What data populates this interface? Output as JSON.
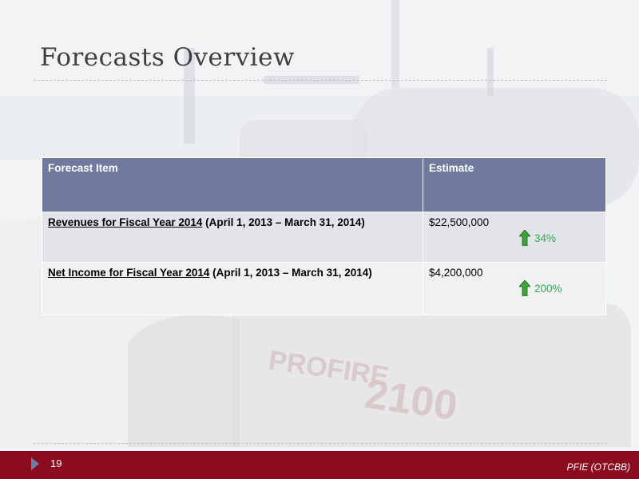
{
  "slide": {
    "title": "Forecasts Overview",
    "page_number": "19",
    "ticker": "PFIE (OTCBB)",
    "background_watermark": "PROFIRE 2100"
  },
  "table": {
    "headers": {
      "item": "Forecast Item",
      "estimate": "Estimate"
    },
    "rows": [
      {
        "item_bold_underlined": "Revenues for Fiscal Year 2014",
        "item_rest": " (April 1, 2013 – March 31, 2014)",
        "estimate": "$22,500,000",
        "change": "34%",
        "change_icon": "green-up-arrow-icon"
      },
      {
        "item_bold_underlined": "Net Income for Fiscal Year 2014",
        "item_rest": " (April 1, 2013 – March 31, 2014)",
        "estimate": "$4,200,000",
        "change": "200%",
        "change_icon": "green-up-arrow-icon"
      }
    ]
  },
  "colors": {
    "header_fill": "#707a9f",
    "row1_fill": "#e3e4e9",
    "row2_fill": "#f1f1f4",
    "footer_bar": "#8c0c1f",
    "change_text": "#2eab4a"
  }
}
